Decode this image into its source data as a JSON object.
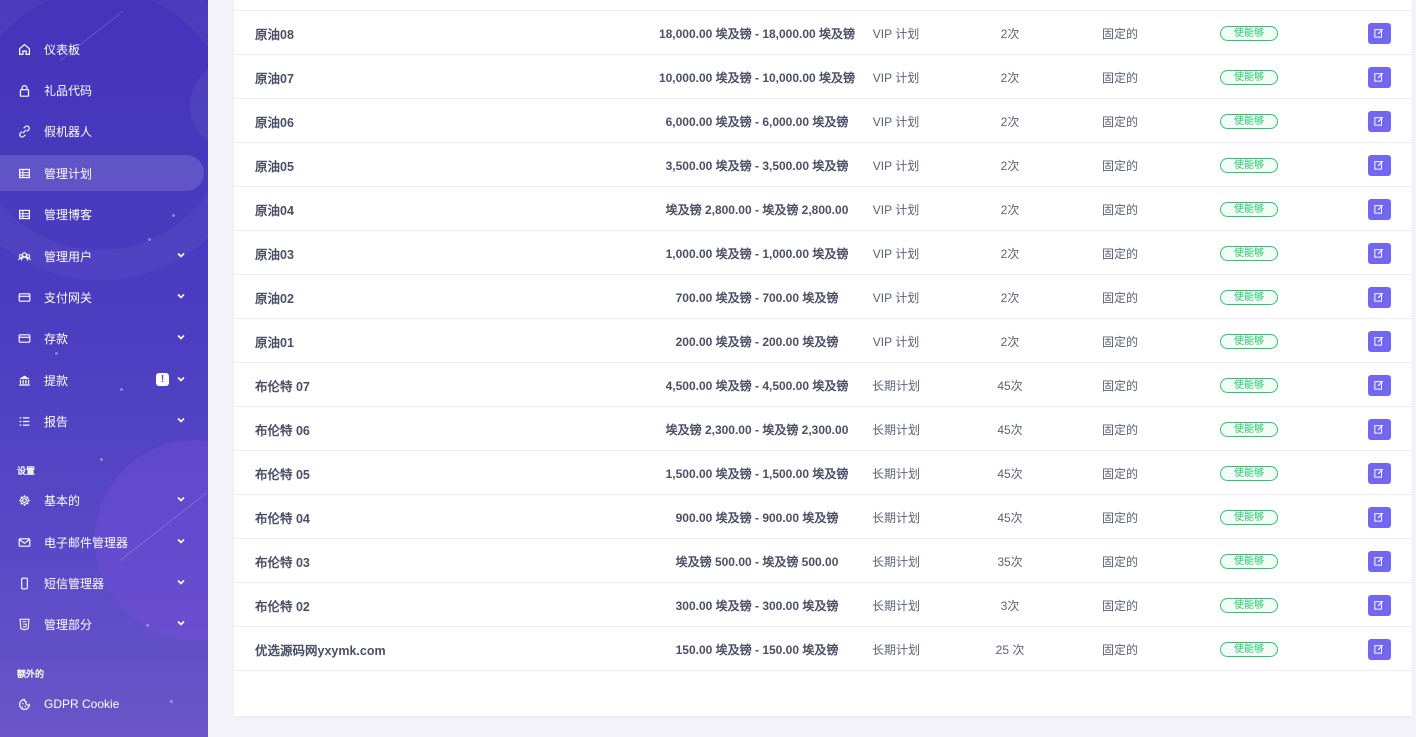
{
  "sidebar": {
    "items": [
      {
        "label": "仪表板",
        "icon": "home-icon"
      },
      {
        "label": "礼品代码",
        "icon": "lock-icon"
      },
      {
        "label": "假机器人",
        "icon": "link-icon"
      },
      {
        "label": "管理计划",
        "icon": "table-icon",
        "active": true
      },
      {
        "label": "管理博客",
        "icon": "table-icon"
      },
      {
        "label": "管理用户",
        "icon": "users-icon",
        "chevron": true
      },
      {
        "label": "支付网关",
        "icon": "credit-card-icon",
        "chevron": true
      },
      {
        "label": "存款",
        "icon": "credit-card-icon",
        "chevron": true
      },
      {
        "label": "提款",
        "icon": "bank-icon",
        "chevron": true,
        "badge": "!"
      },
      {
        "label": "报告",
        "icon": "list-icon",
        "chevron": true
      }
    ],
    "section_settings": "设置",
    "settings_items": [
      {
        "label": "基本的",
        "icon": "gear-icon",
        "chevron": true
      },
      {
        "label": "电子邮件管理器",
        "icon": "mail-icon",
        "chevron": true
      },
      {
        "label": "短信管理器",
        "icon": "phone-icon",
        "chevron": true
      },
      {
        "label": "管理部分",
        "icon": "html-icon",
        "chevron": true
      }
    ],
    "section_extra": "额外的",
    "extra_items": [
      {
        "label": "GDPR Cookie",
        "icon": "cookie-icon"
      }
    ]
  },
  "table": {
    "status_label": "使能够",
    "rows": [
      {
        "name": "原油08",
        "range": "18,000.00 埃及镑 - 18,000.00 埃及镑",
        "type": "VIP 计划",
        "times": "2次",
        "fixed": "固定的"
      },
      {
        "name": "原油07",
        "range": "10,000.00 埃及镑 - 10,000.00 埃及镑",
        "type": "VIP 计划",
        "times": "2次",
        "fixed": "固定的"
      },
      {
        "name": "原油06",
        "range": "6,000.00 埃及镑 - 6,000.00 埃及镑",
        "type": "VIP 计划",
        "times": "2次",
        "fixed": "固定的"
      },
      {
        "name": "原油05",
        "range": "3,500.00 埃及镑 - 3,500.00 埃及镑",
        "type": "VIP 计划",
        "times": "2次",
        "fixed": "固定的"
      },
      {
        "name": "原油04",
        "range": "埃及镑 2,800.00 - 埃及镑 2,800.00",
        "type": "VIP 计划",
        "times": "2次",
        "fixed": "固定的"
      },
      {
        "name": "原油03",
        "range": "1,000.00 埃及镑 - 1,000.00 埃及镑",
        "type": "VIP 计划",
        "times": "2次",
        "fixed": "固定的"
      },
      {
        "name": "原油02",
        "range": "700.00 埃及镑 - 700.00 埃及镑",
        "type": "VIP 计划",
        "times": "2次",
        "fixed": "固定的"
      },
      {
        "name": "原油01",
        "range": "200.00 埃及镑 - 200.00 埃及镑",
        "type": "VIP 计划",
        "times": "2次",
        "fixed": "固定的"
      },
      {
        "name": "布伦特 07",
        "range": "4,500.00 埃及镑 - 4,500.00 埃及镑",
        "type": "长期计划",
        "times": "45次",
        "fixed": "固定的"
      },
      {
        "name": "布伦特 06",
        "range": "埃及镑 2,300.00 - 埃及镑 2,300.00",
        "type": "长期计划",
        "times": "45次",
        "fixed": "固定的"
      },
      {
        "name": "布伦特 05",
        "range": "1,500.00 埃及镑 - 1,500.00 埃及镑",
        "type": "长期计划",
        "times": "45次",
        "fixed": "固定的"
      },
      {
        "name": "布伦特 04",
        "range": "900.00 埃及镑 - 900.00 埃及镑",
        "type": "长期计划",
        "times": "45次",
        "fixed": "固定的"
      },
      {
        "name": "布伦特 03",
        "range": "埃及镑 500.00 - 埃及镑 500.00",
        "type": "长期计划",
        "times": "35次",
        "fixed": "固定的"
      },
      {
        "name": "布伦特 02",
        "range": "300.00 埃及镑 - 300.00 埃及镑",
        "type": "长期计划",
        "times": "3次",
        "fixed": "固定的"
      },
      {
        "name": "优选源码网yxymk.com",
        "range": "150.00 埃及镑 - 150.00 埃及镑",
        "type": "长期计划",
        "times": "25 次",
        "fixed": "固定的"
      }
    ]
  },
  "colors": {
    "accent": "#7367f0",
    "success": "#28c76f",
    "sidebar": "#4a3cc0"
  }
}
